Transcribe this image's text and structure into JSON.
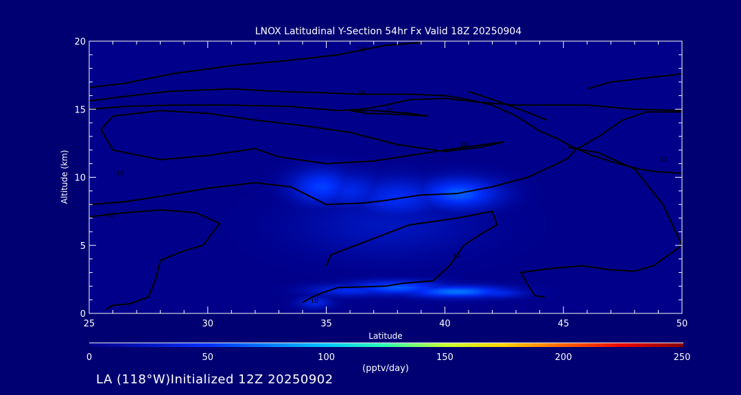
{
  "chart_data": {
    "type": "heatmap",
    "title": "LNOX Latitudinal Y-Section 54hr  Fx Valid 18Z 20250904",
    "xlabel": "Latitude",
    "ylabel": "Altitude (km)",
    "xlim": [
      25,
      50
    ],
    "ylim": [
      0,
      20
    ],
    "xticks": [
      25,
      30,
      35,
      40,
      45,
      50
    ],
    "yticks": [
      0,
      5,
      10,
      15,
      20
    ],
    "colorbar": {
      "min": 0,
      "max": 250,
      "ticks": [
        0,
        50,
        100,
        150,
        200,
        250
      ],
      "units": "(pptv/day)"
    },
    "field_blobs": [
      {
        "lat": 34.8,
        "alt": 9.3,
        "sigma_lat": 0.9,
        "sigma_alt": 0.9,
        "value": 55
      },
      {
        "lat": 36.0,
        "alt": 9.0,
        "sigma_lat": 1.0,
        "sigma_alt": 0.9,
        "value": 40
      },
      {
        "lat": 38.0,
        "alt": 8.5,
        "sigma_lat": 1.3,
        "sigma_alt": 1.0,
        "value": 45
      },
      {
        "lat": 40.6,
        "alt": 8.8,
        "sigma_lat": 1.2,
        "sigma_alt": 0.8,
        "value": 65
      },
      {
        "lat": 37.5,
        "alt": 6.5,
        "sigma_lat": 2.6,
        "sigma_alt": 1.6,
        "value": 22
      },
      {
        "lat": 36.0,
        "alt": 1.7,
        "sigma_lat": 1.2,
        "sigma_alt": 0.3,
        "value": 45
      },
      {
        "lat": 38.0,
        "alt": 1.9,
        "sigma_lat": 1.4,
        "sigma_alt": 0.35,
        "value": 65
      },
      {
        "lat": 40.5,
        "alt": 1.6,
        "sigma_lat": 1.5,
        "sigma_alt": 0.3,
        "value": 75
      },
      {
        "lat": 42.2,
        "alt": 1.5,
        "sigma_lat": 0.8,
        "sigma_alt": 0.25,
        "value": 45
      },
      {
        "lat": 34.5,
        "alt": 0.8,
        "sigma_lat": 0.5,
        "sigma_alt": 0.3,
        "value": 40
      }
    ],
    "contour_label": "10",
    "contours": [
      {
        "points": [
          [
            25,
            16.6
          ],
          [
            26.5,
            16.9
          ],
          [
            28.5,
            17.6
          ],
          [
            31,
            18.2
          ],
          [
            33.5,
            18.6
          ],
          [
            35.5,
            19.0
          ],
          [
            37.5,
            19.7
          ],
          [
            39,
            19.9
          ]
        ],
        "labels": [
          [
            36.5,
            19.4
          ]
        ]
      },
      {
        "points": [
          [
            25,
            15.6
          ],
          [
            26.3,
            15.9
          ],
          [
            28.3,
            16.3
          ],
          [
            31,
            16.5
          ],
          [
            33,
            16.3
          ],
          [
            35,
            16.2
          ],
          [
            36.5,
            16.1
          ],
          [
            38.5,
            16.1
          ],
          [
            40,
            16.0
          ],
          [
            41,
            15.7
          ],
          [
            42,
            15.3
          ],
          [
            43,
            14.5
          ],
          [
            44,
            13.4
          ],
          [
            44.8,
            12.8
          ],
          [
            45.3,
            12.3
          ],
          [
            46.2,
            11.6
          ],
          [
            47.3,
            11.0
          ],
          [
            48.2,
            10.6
          ],
          [
            49,
            10.4
          ],
          [
            50,
            10.3
          ]
        ],
        "labels": [
          [
            36.5,
            16.2
          ]
        ]
      },
      {
        "points": [
          [
            25,
            15.0
          ],
          [
            26.5,
            15.2
          ],
          [
            28.5,
            15.3
          ],
          [
            31,
            15.3
          ],
          [
            33.5,
            15.2
          ],
          [
            35.5,
            14.9
          ],
          [
            36.5,
            15.0
          ],
          [
            37.5,
            15.3
          ],
          [
            38.5,
            15.7
          ],
          [
            40,
            15.8
          ],
          [
            41.5,
            15.5
          ],
          [
            43,
            15.3
          ],
          [
            46,
            15.3
          ],
          [
            48,
            15.0
          ],
          [
            50,
            14.9
          ]
        ],
        "labels": []
      },
      {
        "points": [
          [
            25,
            8.0
          ],
          [
            26.5,
            8.2
          ],
          [
            28,
            8.6
          ],
          [
            30,
            9.2
          ],
          [
            32,
            9.6
          ],
          [
            33.5,
            9.3
          ],
          [
            35,
            8.0
          ],
          [
            36.5,
            8.1
          ],
          [
            37.5,
            8.3
          ],
          [
            39,
            8.7
          ],
          [
            40.5,
            8.8
          ],
          [
            42,
            9.3
          ],
          [
            43.5,
            10.0
          ],
          [
            44.5,
            10.8
          ],
          [
            45.2,
            11.4
          ],
          [
            45.5,
            12.0
          ],
          [
            46.5,
            13.0
          ],
          [
            47.5,
            14.2
          ],
          [
            48.5,
            14.8
          ],
          [
            50,
            14.8
          ]
        ],
        "labels": [
          [
            26.3,
            10.3
          ],
          [
            40.8,
            12.4
          ],
          [
            49.2,
            11.3
          ]
        ]
      },
      {
        "points": [
          [
            36,
            14.9
          ],
          [
            37,
            14.9
          ],
          [
            38.5,
            14.7
          ],
          [
            39.3,
            14.5
          ],
          [
            38.3,
            14.6
          ],
          [
            36.7,
            14.7
          ],
          [
            36,
            14.9
          ]
        ],
        "labels": [
          [
            37.7,
            14.9
          ]
        ]
      },
      {
        "points": [
          [
            26,
            14.5
          ],
          [
            28,
            14.9
          ],
          [
            30,
            14.7
          ],
          [
            32,
            14.2
          ],
          [
            34,
            13.8
          ],
          [
            36,
            13.3
          ],
          [
            38,
            12.4
          ],
          [
            40,
            11.9
          ],
          [
            41.5,
            12.2
          ],
          [
            42.5,
            12.6
          ],
          [
            40,
            12.0
          ],
          [
            37,
            11.2
          ],
          [
            35,
            11.0
          ],
          [
            33,
            11.5
          ],
          [
            32,
            12.1
          ],
          [
            30,
            11.6
          ],
          [
            28,
            11.3
          ],
          [
            26,
            12.0
          ],
          [
            25.5,
            13.5
          ],
          [
            26,
            14.5
          ]
        ],
        "labels": []
      },
      {
        "points": [
          [
            25,
            7.1
          ],
          [
            26.5,
            7.4
          ],
          [
            28,
            7.6
          ],
          [
            29.5,
            7.4
          ],
          [
            30.5,
            6.6
          ],
          [
            29.8,
            5.0
          ],
          [
            29,
            4.6
          ],
          [
            28,
            3.9
          ],
          [
            27.8,
            2.5
          ],
          [
            27.5,
            1.2
          ],
          [
            26.7,
            0.7
          ],
          [
            26,
            0.6
          ],
          [
            25.7,
            0.3
          ]
        ],
        "labels": [
          [
            25.9,
            7.2
          ]
        ]
      },
      {
        "points": [
          [
            35,
            3.5
          ],
          [
            35.2,
            4.3
          ],
          [
            37,
            5.5
          ],
          [
            38.5,
            6.5
          ],
          [
            40.5,
            7.0
          ],
          [
            42,
            7.5
          ],
          [
            42.2,
            6.5
          ],
          [
            41.5,
            5.8
          ],
          [
            40.8,
            5.0
          ],
          [
            40.2,
            3.5
          ],
          [
            39.5,
            2.4
          ],
          [
            38.2,
            2.2
          ],
          [
            37.5,
            2.0
          ],
          [
            35.5,
            1.9
          ],
          [
            34.8,
            1.5
          ],
          [
            34.3,
            1.1
          ],
          [
            34,
            0.8
          ]
        ],
        "labels": [
          [
            40.5,
            4.2
          ],
          [
            34.5,
            0.9
          ]
        ]
      },
      {
        "points": [
          [
            45.2,
            12.2
          ],
          [
            46.5,
            11.8
          ],
          [
            48,
            10.6
          ],
          [
            49.2,
            8.0
          ],
          [
            50,
            5.0
          ],
          [
            48.8,
            3.5
          ],
          [
            48,
            3.1
          ],
          [
            47,
            3.2
          ],
          [
            45.8,
            3.5
          ],
          [
            44.5,
            3.3
          ],
          [
            43.2,
            3.0
          ],
          [
            43.4,
            2.4
          ],
          [
            43.8,
            1.3
          ],
          [
            44.2,
            1.2
          ]
        ],
        "labels": []
      },
      {
        "points": [
          [
            41,
            16.3
          ],
          [
            42.2,
            15.6
          ],
          [
            43.3,
            14.9
          ],
          [
            44.3,
            14.2
          ]
        ],
        "labels": []
      },
      {
        "points": [
          [
            46,
            16.5
          ],
          [
            47,
            17.0
          ],
          [
            48.5,
            17.3
          ],
          [
            50,
            17.6
          ]
        ],
        "labels": []
      }
    ]
  },
  "footer": {
    "text": "LA (118°W)Initialized 12Z 20250902"
  }
}
